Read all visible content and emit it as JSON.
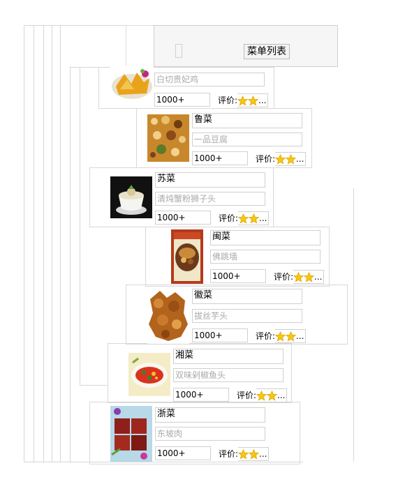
{
  "nav": {
    "title": "菜单列表"
  },
  "items": [
    {
      "category": "",
      "dish": "白切贵妃鸡",
      "count": "1000+",
      "rating_label": "评价:",
      "rating_ellipsis": "..."
    },
    {
      "category": "鲁菜",
      "dish": "一品豆腐",
      "count": "1000+",
      "rating_label": "评价:",
      "rating_ellipsis": "..."
    },
    {
      "category": "苏菜",
      "dish": "清炖蟹粉狮子头",
      "count": "1000+",
      "rating_label": "评价:",
      "rating_ellipsis": "..."
    },
    {
      "category": "闽菜",
      "dish": "佛跳墙",
      "count": "1000+",
      "rating_label": "评价:",
      "rating_ellipsis": "..."
    },
    {
      "category": "徽菜",
      "dish": "拔丝芋头",
      "count": "1000+",
      "rating_label": "评价:",
      "rating_ellipsis": "..."
    },
    {
      "category": "湘菜",
      "dish": "双味剁椒鱼头",
      "count": "1000+",
      "rating_label": "评价:",
      "rating_ellipsis": "..."
    },
    {
      "category": "浙菜",
      "dish": "东坡肉",
      "count": "1000+",
      "rating_label": "评价:",
      "rating_ellipsis": "..."
    }
  ],
  "colors": {
    "star": "#f5c518",
    "star_stroke": "#e0a800",
    "placeholder": "#aaaaaa",
    "border": "#d0d0d0"
  }
}
